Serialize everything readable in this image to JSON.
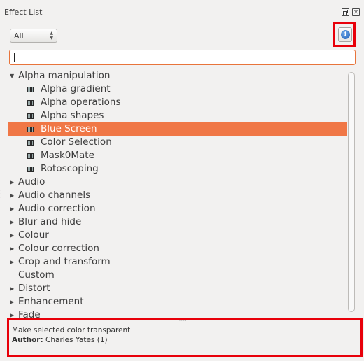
{
  "panel": {
    "title": "Effect List",
    "float_button": "float-icon",
    "close_button": "close-icon"
  },
  "filter": {
    "selected": "All"
  },
  "info_button": {
    "icon": "info-icon",
    "glyph": "i"
  },
  "search": {
    "value": "",
    "placeholder": ""
  },
  "tree": [
    {
      "label": "Alpha manipulation",
      "expanded": true,
      "children": [
        {
          "label": "Alpha gradient"
        },
        {
          "label": "Alpha operations"
        },
        {
          "label": "Alpha shapes"
        },
        {
          "label": "Blue Screen",
          "selected": true
        },
        {
          "label": "Color Selection"
        },
        {
          "label": "Mask0Mate"
        },
        {
          "label": "Rotoscoping"
        }
      ]
    },
    {
      "label": "Audio",
      "expanded": false
    },
    {
      "label": "Audio channels",
      "expanded": false
    },
    {
      "label": "Audio correction",
      "expanded": false
    },
    {
      "label": "Blur and hide",
      "expanded": false
    },
    {
      "label": "Colour",
      "expanded": false
    },
    {
      "label": "Colour correction",
      "expanded": false
    },
    {
      "label": "Crop and transform",
      "expanded": false
    },
    {
      "label": "Custom",
      "expanded": false,
      "leaf": true
    },
    {
      "label": "Distort",
      "expanded": false
    },
    {
      "label": "Enhancement",
      "expanded": false
    },
    {
      "label": "Fade",
      "expanded": false
    }
  ],
  "description": {
    "text": "Make selected color transparent",
    "author_label": "Author:",
    "author_value": "Charles Yates (1)"
  },
  "colors": {
    "selection": "#f07746",
    "highlight_box": "#e8000a",
    "search_border": "#e8743b"
  }
}
